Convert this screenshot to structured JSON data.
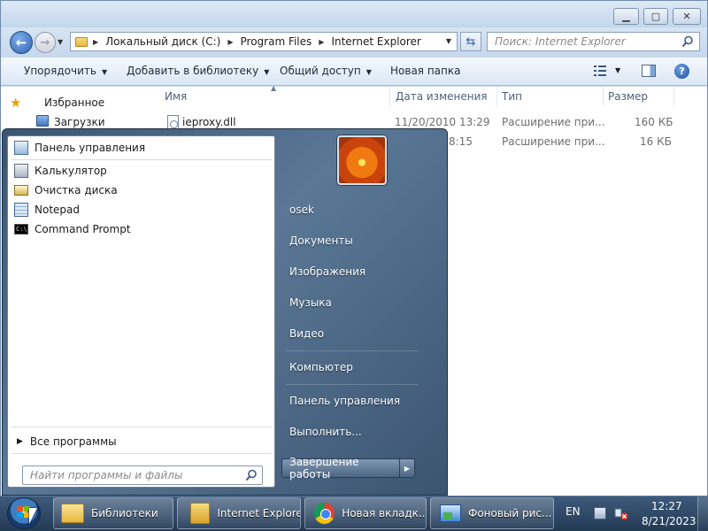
{
  "explorer": {
    "address": {
      "crumbs": [
        "Локальный диск (C:)",
        "Program Files",
        "Internet Explorer"
      ]
    },
    "search_placeholder": "Поиск: Internet Explorer",
    "toolbar": {
      "organize": "Упорядочить",
      "add_to_library": "Добавить в библиотеку",
      "share": "Общий доступ",
      "new_folder": "Новая папка"
    },
    "nav": {
      "favorites": "Избранное",
      "downloads": "Загрузки"
    },
    "columns": {
      "name": "Имя",
      "date": "Дата изменения",
      "type": "Тип",
      "size": "Размер"
    },
    "files": [
      {
        "name": "ieproxy.dll",
        "date": "11/20/2010 13:29",
        "type": "Расширение при...",
        "size": "160 КБ"
      },
      {
        "name": "",
        "date": "8:15",
        "type": "Расширение при...",
        "size": "16 КБ"
      }
    ]
  },
  "start_menu": {
    "pinned": [
      {
        "label": "Панель управления",
        "icon": "control-panel-icon"
      },
      {
        "label": "Калькулятор",
        "icon": "calculator-icon"
      },
      {
        "label": "Очистка диска",
        "icon": "disk-cleanup-icon"
      },
      {
        "label": "Notepad",
        "icon": "notepad-icon"
      },
      {
        "label": "Command Prompt",
        "icon": "command-prompt-icon"
      }
    ],
    "all_programs": "Все программы",
    "search_placeholder": "Найти программы и файлы",
    "right": {
      "user": "osek",
      "documents": "Документы",
      "pictures": "Изображения",
      "music": "Музыка",
      "video": "Видео",
      "computer": "Компьютер",
      "control_panel": "Панель управления",
      "run": "Выполнить..."
    },
    "shutdown": "Завершение работы"
  },
  "taskbar": {
    "tasks": [
      {
        "label": "Библиотеки",
        "icon": "libraries-icon"
      },
      {
        "label": "Internet Explorer",
        "icon": "folder-icon"
      },
      {
        "label": "Новая вкладк...",
        "icon": "chrome-icon"
      },
      {
        "label": "Фоновый рис...",
        "icon": "desktop-background-icon"
      }
    ],
    "language": "EN",
    "time": "12:27",
    "date": "8/21/2023"
  },
  "colors": {
    "taskbar": "#2d4662",
    "start_menu_right": "#4d6a88",
    "accent_blue": "#2d64b4"
  }
}
